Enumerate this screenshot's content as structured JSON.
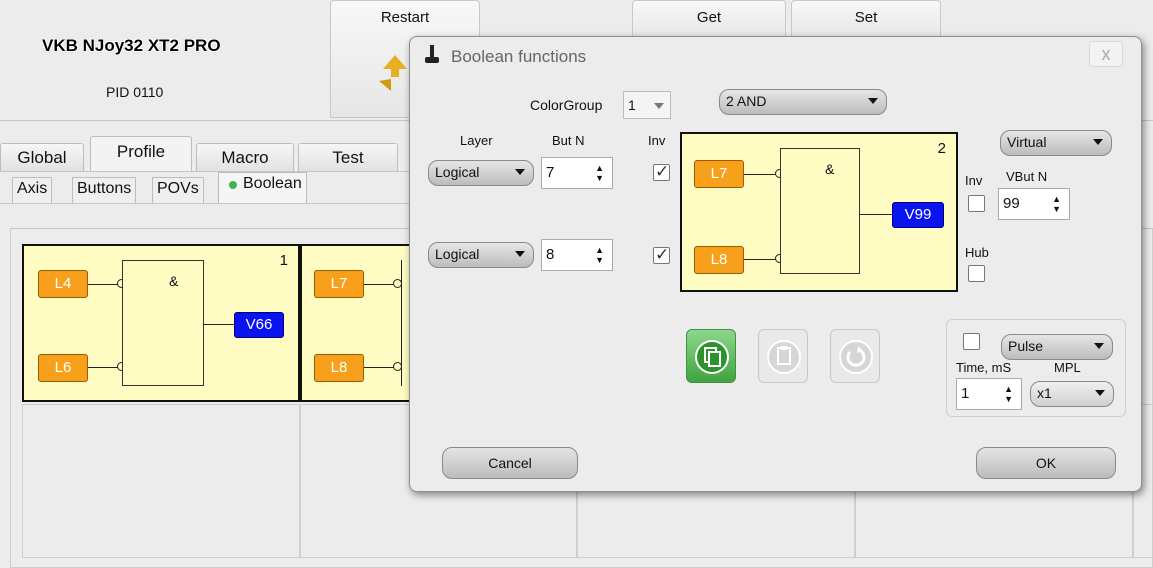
{
  "app": {
    "device_name": "VKB NJoy32 XT2 PRO",
    "pid": "PID 0110",
    "restart_label": "Restart",
    "get_label": "Get",
    "set_label": "Set"
  },
  "main_tabs": [
    "Global",
    "Profile",
    "Macro",
    "Test"
  ],
  "sub_tabs": [
    "Axis",
    "Buttons",
    "POVs",
    "Boolean"
  ],
  "functions": [
    {
      "number": "1",
      "gate": "&",
      "inputs": [
        "L4",
        "L6"
      ],
      "output": "V66"
    },
    {
      "number": "",
      "gate": "",
      "inputs": [
        "L7",
        "L8"
      ],
      "output": ""
    }
  ],
  "dialog": {
    "title": "Boolean functions",
    "close": "x",
    "colorgroup_label": "ColorGroup",
    "colorgroup_value": "1",
    "function_type": "2 AND",
    "layer_label": "Layer",
    "butn_label": "But N",
    "inv_label": "Inv",
    "rows": [
      {
        "layer": "Logical",
        "but_n": "7",
        "inv": true
      },
      {
        "layer": "Logical",
        "but_n": "8",
        "inv": true
      }
    ],
    "preview": {
      "number": "2",
      "gate": "&",
      "inputs": [
        "L7",
        "L8"
      ],
      "output": "V99"
    },
    "output_type": "Virtual",
    "out_inv_label": "Inv",
    "vbutn_label": "VBut N",
    "vbutn_value": "99",
    "hub_label": "Hub",
    "pulse_mode": "Pulse",
    "time_label": "Time, mS",
    "mpl_label": "MPL",
    "time_value": "1",
    "mpl_value": "x1",
    "cancel_label": "Cancel",
    "ok_label": "OK"
  },
  "colors": {
    "input_box": "#f7a01b",
    "output_box": "#0a14ee",
    "function_bg": "#fefcc2",
    "active_dot": "#3cb54a"
  }
}
